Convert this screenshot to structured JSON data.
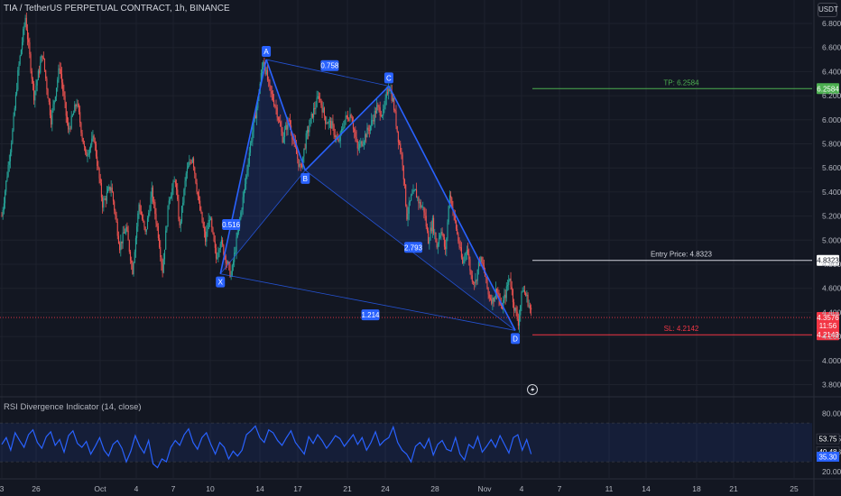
{
  "header": {
    "symbol_title": "TIA / TetherUS PERPETUAL CONTRACT, 1h, BINANCE",
    "currency_button": "USDT",
    "rsi_title": "RSI Divergence Indicator (14, close)"
  },
  "colors": {
    "background": "#131722",
    "grid": "#1e222d",
    "pattern_line": "#2962ff",
    "pattern_fill": "rgba(41,98,255,0.14)",
    "tp": "#4caf50",
    "entry": "#d1d4dc",
    "sl": "#f23645",
    "candle_up": "#26a69a",
    "candle_down": "#ef5350",
    "rsi_line": "#2962ff",
    "rsi_band": "rgba(41,98,255,0.10)"
  },
  "chart_data": [
    {
      "type": "candlestick",
      "title": "TIA / TetherUS PERPETUAL CONTRACT, 1h, BINANCE",
      "ylim": [
        3.7,
        6.95
      ],
      "y_ticks": [
        3.8,
        4.0,
        4.2,
        4.4,
        4.6,
        4.8,
        5.0,
        5.2,
        5.4,
        5.6,
        5.8,
        6.0,
        6.2,
        6.4,
        6.6,
        6.8
      ],
      "x_ticks": [
        "3",
        "26",
        "Oct",
        "4",
        "7",
        "10",
        "14",
        "17",
        "21",
        "24",
        "28",
        "Nov",
        "4",
        "7",
        "11",
        "14",
        "18",
        "21",
        "25"
      ],
      "price_path": [
        [
          0,
          5.2
        ],
        [
          2.5,
          5.9
        ],
        [
          3.8,
          6.4
        ],
        [
          5.5,
          6.85
        ],
        [
          7.5,
          6.2
        ],
        [
          9.5,
          6.55
        ],
        [
          11.5,
          6.0
        ],
        [
          13.5,
          6.45
        ],
        [
          15.5,
          5.9
        ],
        [
          17.5,
          6.15
        ],
        [
          19.5,
          5.7
        ],
        [
          21.5,
          5.85
        ],
        [
          23.5,
          5.3
        ],
        [
          25.5,
          5.45
        ],
        [
          27.5,
          4.95
        ],
        [
          29,
          5.1
        ],
        [
          30.5,
          4.75
        ],
        [
          32,
          5.3
        ],
        [
          33.5,
          5.05
        ],
        [
          35,
          5.4
        ],
        [
          36.5,
          5.05
        ],
        [
          37.5,
          4.75
        ],
        [
          39,
          5.35
        ],
        [
          40.5,
          5.5
        ],
        [
          41.5,
          5.1
        ],
        [
          43,
          5.55
        ],
        [
          44.5,
          5.7
        ],
        [
          46,
          5.3
        ],
        [
          47.5,
          5.0
        ],
        [
          48.5,
          5.2
        ],
        [
          50,
          4.85
        ],
        [
          51,
          5.0
        ],
        [
          52.5,
          4.82
        ],
        [
          53.5,
          4.7
        ],
        [
          55,
          5.05
        ],
        [
          56.5,
          5.4
        ],
        [
          58,
          5.8
        ],
        [
          59.5,
          6.1
        ],
        [
          61,
          6.5
        ],
        [
          62.5,
          6.25
        ],
        [
          64,
          6.1
        ],
        [
          65.5,
          5.85
        ],
        [
          67,
          6.0
        ],
        [
          68.5,
          5.75
        ],
        [
          69.7,
          5.58
        ],
        [
          71,
          5.85
        ],
        [
          72.5,
          6.05
        ],
        [
          74,
          6.2
        ],
        [
          75.5,
          6.0
        ],
        [
          77,
          5.95
        ],
        [
          78.5,
          5.8
        ],
        [
          80,
          6.0
        ],
        [
          81.5,
          6.05
        ],
        [
          83,
          5.75
        ],
        [
          84.5,
          5.85
        ],
        [
          86,
          5.95
        ],
        [
          87.5,
          6.1
        ],
        [
          89,
          6.05
        ],
        [
          90.3,
          6.3
        ],
        [
          91.3,
          6.15
        ],
        [
          92.5,
          5.85
        ],
        [
          93.5,
          5.65
        ],
        [
          94.5,
          5.2
        ],
        [
          95.5,
          5.35
        ],
        [
          96.5,
          5.4
        ],
        [
          97.5,
          5.3
        ],
        [
          98.5,
          5.25
        ],
        [
          99.5,
          5.0
        ],
        [
          100.5,
          5.15
        ],
        [
          101.5,
          4.95
        ],
        [
          102.5,
          5.1
        ],
        [
          103.5,
          4.9
        ],
        [
          104.5,
          5.4
        ],
        [
          105.5,
          5.2
        ],
        [
          106.5,
          5.0
        ],
        [
          107.5,
          4.8
        ],
        [
          108.5,
          4.95
        ],
        [
          109.5,
          4.7
        ],
        [
          110.5,
          4.65
        ],
        [
          111.5,
          4.85
        ],
        [
          112.5,
          4.75
        ],
        [
          113.5,
          4.55
        ],
        [
          114.5,
          4.5
        ],
        [
          115.5,
          4.6
        ],
        [
          116.5,
          4.42
        ],
        [
          117.5,
          4.55
        ],
        [
          118.5,
          4.7
        ],
        [
          119.5,
          4.45
        ],
        [
          120.5,
          4.32
        ],
        [
          121.5,
          4.6
        ],
        [
          122.5,
          4.52
        ],
        [
          123.5,
          4.4
        ]
      ],
      "harmonic_points": [
        {
          "label": "X",
          "t": 51,
          "price": 4.72
        },
        {
          "label": "A",
          "t": 61.7,
          "price": 6.5
        },
        {
          "label": "B",
          "t": 70.8,
          "price": 5.58
        },
        {
          "label": "C",
          "t": 90.3,
          "price": 6.28
        },
        {
          "label": "D",
          "t": 119.8,
          "price": 4.25
        }
      ],
      "ratios": [
        {
          "value": "0.516",
          "legs": "XA-AB"
        },
        {
          "value": "0.758",
          "legs": "A-C"
        },
        {
          "value": "2.793",
          "legs": "BC-CD"
        },
        {
          "value": "1.214",
          "legs": "X-D"
        }
      ],
      "levels": [
        {
          "name": "TP",
          "label": "TP: 6.2584",
          "price": 6.2584,
          "axis_tag": "6.2584"
        },
        {
          "name": "Entry Price",
          "label": "Entry Price: 4.8323",
          "price": 4.8323,
          "axis_tag": "4.8323"
        },
        {
          "name": "SL",
          "label": "SL: 4.2142",
          "price": 4.2142,
          "axis_tag": "4.2143"
        }
      ],
      "current_price": {
        "price": 4.3576,
        "axis_tag": "4.3576",
        "countdown": "11:56"
      }
    },
    {
      "type": "line",
      "title": "RSI Divergence Indicator (14, close)",
      "ylim": [
        18,
        85
      ],
      "y_ticks": [
        20.0,
        40.48,
        53.75,
        80.0
      ],
      "axis_tags": [
        "53.75",
        "40.48",
        "35.30"
      ],
      "band": [
        30,
        70
      ],
      "values": [
        48,
        55,
        42,
        60,
        52,
        45,
        58,
        63,
        50,
        44,
        56,
        61,
        47,
        53,
        40,
        57,
        62,
        49,
        45,
        51,
        38,
        46,
        55,
        42,
        36,
        48,
        52,
        44,
        30,
        41,
        57,
        46,
        39,
        52,
        28,
        24,
        33,
        30,
        45,
        52,
        47,
        58,
        64,
        50,
        43,
        55,
        60,
        48,
        38,
        50,
        45,
        33,
        41,
        36,
        42,
        58,
        62,
        67,
        55,
        50,
        63,
        60,
        52,
        47,
        55,
        62,
        50,
        44,
        38,
        56,
        49,
        58,
        52,
        44,
        50,
        57,
        54,
        46,
        52,
        58,
        48,
        55,
        42,
        50,
        61,
        47,
        52,
        55,
        66,
        50,
        42,
        38,
        30,
        46,
        50,
        44,
        54,
        37,
        48,
        52,
        43,
        41,
        55,
        38,
        32,
        48,
        44,
        56,
        40,
        46,
        53,
        45,
        57,
        48,
        39,
        55,
        58,
        42,
        53,
        38
      ]
    }
  ]
}
